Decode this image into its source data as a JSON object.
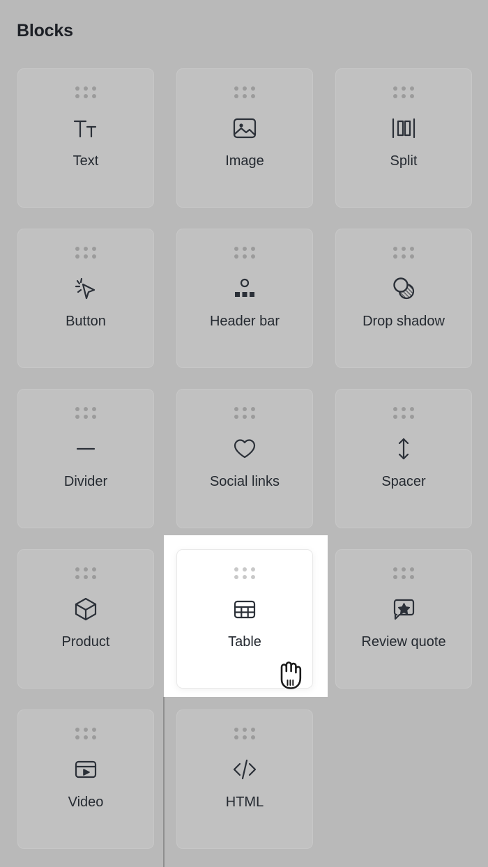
{
  "panel": {
    "title": "Blocks"
  },
  "colors": {
    "background": "#b9b9b9",
    "card_background": "#c1c1c1",
    "card_border": "#c7c7c7",
    "icon": "#2b3038",
    "label": "#252a31",
    "drag_dot": "#9b9b9b",
    "highlight_background": "#ffffff",
    "drop_line": "#8f8f8f"
  },
  "cursor": {
    "icon": "grabbing-hand-cursor"
  },
  "blocks": [
    {
      "label": "Text",
      "icon": "text-size-icon",
      "dragging": false
    },
    {
      "label": "Image",
      "icon": "image-icon",
      "dragging": false
    },
    {
      "label": "Split",
      "icon": "split-columns-icon",
      "dragging": false
    },
    {
      "label": "Button",
      "icon": "click-cursor-icon",
      "dragging": false
    },
    {
      "label": "Header bar",
      "icon": "header-bar-icon",
      "dragging": false
    },
    {
      "label": "Drop shadow",
      "icon": "drop-shadow-icon",
      "dragging": false
    },
    {
      "label": "Divider",
      "icon": "divider-icon",
      "dragging": false
    },
    {
      "label": "Social links",
      "icon": "heart-icon",
      "dragging": false
    },
    {
      "label": "Spacer",
      "icon": "vertical-arrows-icon",
      "dragging": false
    },
    {
      "label": "Product",
      "icon": "cube-icon",
      "dragging": false
    },
    {
      "label": "Table",
      "icon": "table-icon",
      "dragging": true
    },
    {
      "label": "Review quote",
      "icon": "star-speech-bubble-icon",
      "dragging": false
    },
    {
      "label": "Video",
      "icon": "video-player-icon",
      "dragging": false
    },
    {
      "label": "HTML",
      "icon": "code-brackets-icon",
      "dragging": false
    }
  ]
}
